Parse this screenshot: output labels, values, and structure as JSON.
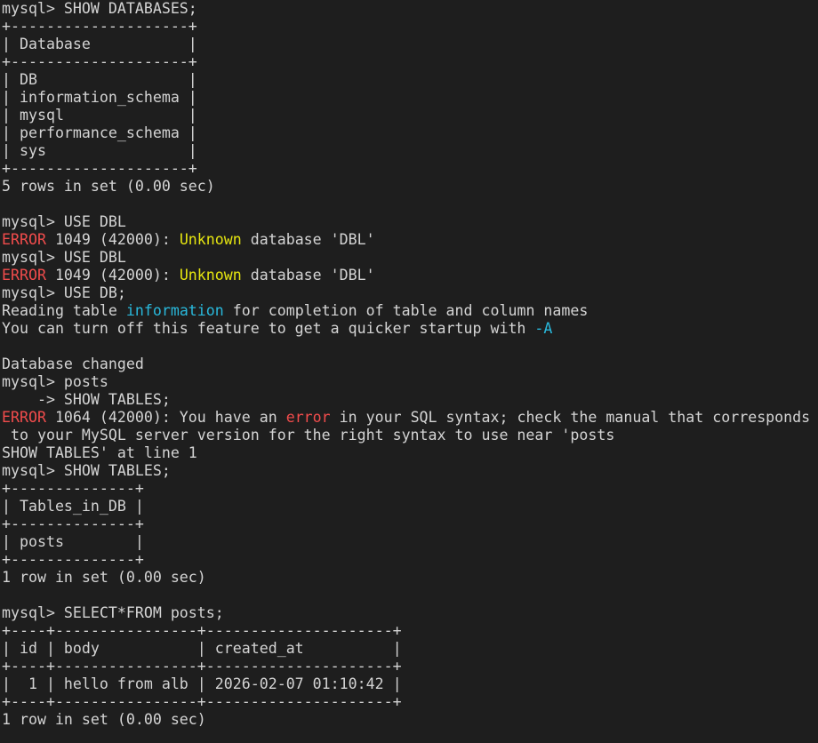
{
  "colors": {
    "background": "#1e1e1e",
    "text": "#d4d4d4",
    "error": "#f14c4c",
    "warning": "#e5e510",
    "info": "#29b8db"
  },
  "lines": [
    [
      {
        "t": "mysql> SHOW DATABASES;"
      }
    ],
    [
      {
        "t": "+--------------------+"
      }
    ],
    [
      {
        "t": "| Database           |"
      }
    ],
    [
      {
        "t": "+--------------------+"
      }
    ],
    [
      {
        "t": "| DB                 |"
      }
    ],
    [
      {
        "t": "| information_schema |"
      }
    ],
    [
      {
        "t": "| mysql              |"
      }
    ],
    [
      {
        "t": "| performance_schema |"
      }
    ],
    [
      {
        "t": "| sys                |"
      }
    ],
    [
      {
        "t": "+--------------------+"
      }
    ],
    [
      {
        "t": "5 rows in set (0.00 sec)"
      }
    ],
    [
      {
        "t": ""
      }
    ],
    [
      {
        "t": "mysql> USE DBL"
      }
    ],
    [
      {
        "t": "ERROR",
        "c": "err"
      },
      {
        "t": " 1049 (42000): "
      },
      {
        "t": "Unknown",
        "c": "warn"
      },
      {
        "t": " database 'DBL'"
      }
    ],
    [
      {
        "t": "mysql> USE DBL"
      }
    ],
    [
      {
        "t": "ERROR",
        "c": "err"
      },
      {
        "t": " 1049 (42000): "
      },
      {
        "t": "Unknown",
        "c": "warn"
      },
      {
        "t": " database 'DBL'"
      }
    ],
    [
      {
        "t": "mysql> USE DB;"
      }
    ],
    [
      {
        "t": "Reading table "
      },
      {
        "t": "information",
        "c": "info"
      },
      {
        "t": " for completion of table and column names"
      }
    ],
    [
      {
        "t": "You can turn off this feature to get a quicker startup with "
      },
      {
        "t": "-A",
        "c": "info"
      }
    ],
    [
      {
        "t": ""
      }
    ],
    [
      {
        "t": "Database changed"
      }
    ],
    [
      {
        "t": "mysql> posts"
      }
    ],
    [
      {
        "t": "    -> SHOW TABLES;"
      }
    ],
    [
      {
        "t": "ERROR",
        "c": "err"
      },
      {
        "t": " 1064 (42000): You have an "
      },
      {
        "t": "error",
        "c": "err"
      },
      {
        "t": " in your SQL syntax; check the manual that corresponds"
      }
    ],
    [
      {
        "t": " to your MySQL server version for the right syntax to use near 'posts"
      }
    ],
    [
      {
        "t": "SHOW TABLES' at line 1"
      }
    ],
    [
      {
        "t": "mysql> SHOW TABLES;"
      }
    ],
    [
      {
        "t": "+--------------+"
      }
    ],
    [
      {
        "t": "| Tables_in_DB |"
      }
    ],
    [
      {
        "t": "+--------------+"
      }
    ],
    [
      {
        "t": "| posts        |"
      }
    ],
    [
      {
        "t": "+--------------+"
      }
    ],
    [
      {
        "t": "1 row in set (0.00 sec)"
      }
    ],
    [
      {
        "t": ""
      }
    ],
    [
      {
        "t": "mysql> SELECT*FROM posts;"
      }
    ],
    [
      {
        "t": "+----+----------------+---------------------+"
      }
    ],
    [
      {
        "t": "| id | body           | created_at          |"
      }
    ],
    [
      {
        "t": "+----+----------------+---------------------+"
      }
    ],
    [
      {
        "t": "|  1 | hello from alb | 2026-02-07 01:10:42 |"
      }
    ],
    [
      {
        "t": "+----+----------------+---------------------+"
      }
    ],
    [
      {
        "t": "1 row in set (0.00 sec)"
      }
    ]
  ]
}
